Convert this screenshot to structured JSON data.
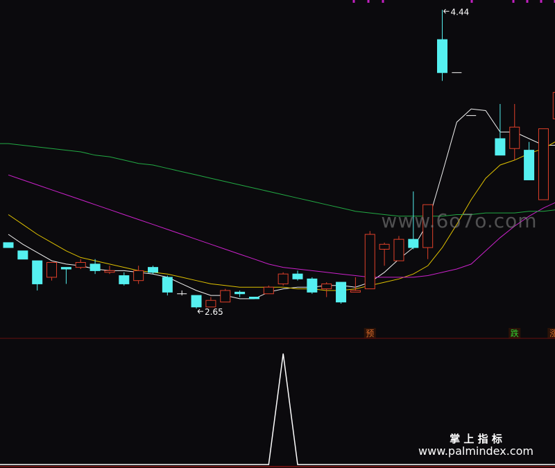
{
  "chart_data": {
    "type": "candlestick",
    "price_panel": {
      "ylim": [
        2.45,
        4.5
      ],
      "candles": [
        {
          "o": 3.03,
          "c": 3.0,
          "h": 3.03,
          "l": 3.0
        },
        {
          "o": 2.98,
          "c": 2.93,
          "h": 2.98,
          "l": 2.93
        },
        {
          "o": 2.92,
          "c": 2.78,
          "h": 2.92,
          "l": 2.74
        },
        {
          "o": 2.82,
          "c": 2.91,
          "h": 2.91,
          "l": 2.8
        },
        {
          "o": 2.88,
          "c": 2.87,
          "h": 2.88,
          "l": 2.78
        },
        {
          "o": 2.88,
          "c": 2.91,
          "h": 2.93,
          "l": 2.87
        },
        {
          "o": 2.9,
          "c": 2.86,
          "h": 2.93,
          "l": 2.84
        },
        {
          "o": 2.85,
          "c": 2.86,
          "h": 2.89,
          "l": 2.84
        },
        {
          "o": 2.83,
          "c": 2.78,
          "h": 2.85,
          "l": 2.77
        },
        {
          "o": 2.8,
          "c": 2.86,
          "h": 2.89,
          "l": 2.78
        },
        {
          "o": 2.88,
          "c": 2.85,
          "h": 2.89,
          "l": 2.84
        },
        {
          "o": 2.82,
          "c": 2.73,
          "h": 2.83,
          "l": 2.71
        },
        {
          "o": 2.72,
          "c": 2.72,
          "h": 2.74,
          "l": 2.71
        },
        {
          "o": 2.71,
          "c": 2.64,
          "h": 2.71,
          "l": 2.63
        },
        {
          "o": 2.64,
          "c": 2.68,
          "h": 2.7,
          "l": 2.64
        },
        {
          "o": 2.67,
          "c": 2.74,
          "h": 2.75,
          "l": 2.67
        },
        {
          "o": 2.73,
          "c": 2.72,
          "h": 2.74,
          "l": 2.7
        },
        {
          "o": 2.7,
          "c": 2.69,
          "h": 2.7,
          "l": 2.69
        },
        {
          "o": 2.72,
          "c": 2.76,
          "h": 2.77,
          "l": 2.72
        },
        {
          "o": 2.78,
          "c": 2.84,
          "h": 2.85,
          "l": 2.77
        },
        {
          "o": 2.84,
          "c": 2.81,
          "h": 2.86,
          "l": 2.8
        },
        {
          "o": 2.81,
          "c": 2.73,
          "h": 2.82,
          "l": 2.72
        },
        {
          "o": 2.75,
          "c": 2.78,
          "h": 2.79,
          "l": 2.7
        },
        {
          "o": 2.79,
          "c": 2.67,
          "h": 2.79,
          "l": 2.66
        },
        {
          "o": 2.73,
          "c": 2.74,
          "h": 2.82,
          "l": 2.73
        },
        {
          "o": 2.75,
          "c": 3.08,
          "h": 3.1,
          "l": 2.75
        },
        {
          "o": 2.99,
          "c": 3.02,
          "h": 3.03,
          "l": 2.89
        },
        {
          "o": 2.92,
          "c": 3.05,
          "h": 3.07,
          "l": 2.92
        },
        {
          "o": 3.05,
          "c": 3.0,
          "h": 3.34,
          "l": 2.99
        },
        {
          "o": 3.0,
          "c": 3.26,
          "h": 3.26,
          "l": 2.93
        },
        {
          "o": 4.26,
          "c": 4.06,
          "h": 4.44,
          "l": 4.01
        },
        {
          "o": 4.06,
          "c": 4.06,
          "h": 4.06,
          "l": 4.06
        },
        {
          "o": 3.8,
          "c": 3.8,
          "h": 3.8,
          "l": 3.8
        },
        {
          "o": 3.71,
          "c": 3.71,
          "h": 3.71,
          "l": 3.71
        },
        {
          "o": 3.66,
          "c": 3.56,
          "h": 3.87,
          "l": 3.56
        },
        {
          "o": 3.6,
          "c": 3.73,
          "h": 3.87,
          "l": 3.53
        },
        {
          "o": 3.59,
          "c": 3.41,
          "h": 3.64,
          "l": 3.41
        },
        {
          "o": 3.29,
          "c": 3.72,
          "h": 3.72,
          "l": 3.3
        },
        {
          "o": 3.78,
          "c": 3.94,
          "h": 3.94,
          "l": 3.72
        }
      ],
      "ma_lines": [
        {
          "name": "MA5",
          "color": "#f2f2f2",
          "values": [
            3.08,
            3.02,
            2.97,
            2.92,
            2.9,
            2.89,
            2.87,
            2.86,
            2.86,
            2.85,
            2.84,
            2.82,
            2.78,
            2.74,
            2.71,
            2.71,
            2.69,
            2.69,
            2.73,
            2.75,
            2.76,
            2.76,
            2.77,
            2.77,
            2.76,
            2.79,
            2.85,
            2.93,
            3.0,
            3.15,
            3.45,
            3.76,
            3.84,
            3.83,
            3.7,
            3.7,
            3.66,
            3.62,
            3.62
          ]
        },
        {
          "name": "MA10",
          "color": "#e0c200",
          "values": [
            3.2,
            3.14,
            3.08,
            3.03,
            2.98,
            2.94,
            2.92,
            2.9,
            2.88,
            2.86,
            2.85,
            2.84,
            2.82,
            2.8,
            2.78,
            2.77,
            2.76,
            2.76,
            2.76,
            2.76,
            2.75,
            2.75,
            2.74,
            2.74,
            2.75,
            2.77,
            2.79,
            2.81,
            2.84,
            2.89,
            3.0,
            3.14,
            3.29,
            3.42,
            3.5,
            3.53,
            3.57,
            3.6,
            3.65
          ]
        },
        {
          "name": "MA30",
          "color": "#cc22cc",
          "values": [
            3.44,
            3.41,
            3.38,
            3.35,
            3.32,
            3.29,
            3.26,
            3.23,
            3.2,
            3.17,
            3.14,
            3.11,
            3.08,
            3.05,
            3.02,
            2.99,
            2.96,
            2.93,
            2.9,
            2.88,
            2.87,
            2.86,
            2.85,
            2.84,
            2.83,
            2.82,
            2.82,
            2.82,
            2.82,
            2.83,
            2.85,
            2.87,
            2.9,
            2.98,
            3.06,
            3.13,
            3.19,
            3.24,
            3.28
          ]
        },
        {
          "name": "MA60",
          "color": "#22aa44",
          "values": [
            3.63,
            3.62,
            3.61,
            3.6,
            3.59,
            3.58,
            3.56,
            3.55,
            3.53,
            3.51,
            3.5,
            3.48,
            3.46,
            3.44,
            3.42,
            3.4,
            3.38,
            3.36,
            3.34,
            3.32,
            3.3,
            3.28,
            3.26,
            3.24,
            3.22,
            3.21,
            3.2,
            3.19,
            3.19,
            3.19,
            3.19,
            3.2,
            3.2,
            3.21,
            3.21,
            3.21,
            3.22,
            3.22,
            3.23
          ]
        }
      ],
      "extra_dashes": [
        {
          "candle": 31,
          "value": 4.06
        },
        {
          "candle": 32,
          "value": 3.8
        }
      ],
      "annotations": {
        "high_label": "4.44",
        "high_candle": 30,
        "low_label": "2.65",
        "low_candle": 13
      }
    },
    "signals": [
      {
        "label": "预",
        "candle": 25,
        "color": "#d86a2a"
      },
      {
        "label": "跌",
        "candle": 35,
        "color": "#30d030"
      },
      {
        "label": "涨榜",
        "candle": 38,
        "color": "#d86a2a"
      }
    ],
    "indicator_panel": {
      "ylim": [
        0,
        1
      ],
      "values": [
        0,
        0,
        0,
        0,
        0,
        0,
        0,
        0,
        0,
        0,
        0,
        0,
        0,
        0,
        0,
        0,
        0,
        0,
        0,
        1,
        0,
        0,
        0,
        0,
        0,
        0,
        0,
        0,
        0,
        0,
        0,
        0,
        0,
        0,
        0,
        0,
        0,
        0,
        0
      ]
    }
  },
  "watermarks": {
    "mid": "www.6o7o.com",
    "brand_cn": "掌 上 指 标",
    "brand_url": "www.palmindex.com"
  },
  "colors": {
    "background": "#0b0a0d",
    "up": "#e0402a",
    "down": "#55f0f0",
    "divider": "#6a1010",
    "indicator_line": "#ffffff",
    "top_ticks": "#c020c0"
  }
}
